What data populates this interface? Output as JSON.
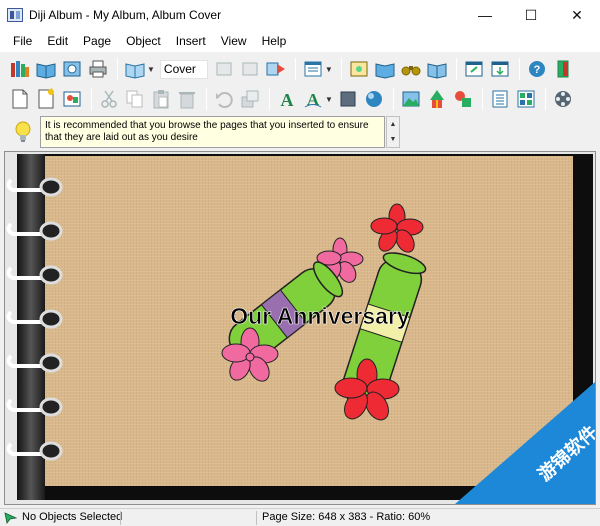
{
  "window": {
    "title": "Diji Album - My Album, Album Cover",
    "minimize": "—",
    "maximize": "☐",
    "close": "✕"
  },
  "menu": [
    "File",
    "Edit",
    "Page",
    "Object",
    "Insert",
    "View",
    "Help"
  ],
  "toolbar": {
    "page_selector_value": "Cover"
  },
  "hint": {
    "text": "It is recommended that you browse the pages that you inserted to ensure that they are laid out as you desire",
    "scroll_up": "▲",
    "scroll_down": "▼"
  },
  "page": {
    "title_text": "Our Anniversary"
  },
  "status": {
    "selection": "No Objects Selected",
    "page_info": "Page Size: 648 x 383 - Ratio: 60%"
  },
  "watermark": {
    "text": "游锦软件"
  },
  "colors": {
    "linen": "#d9b98d",
    "flower_pink": "#f06aa0",
    "flower_red": "#ee2a35",
    "tube_green": "#7fd03a",
    "band_purple": "#9a6fb0",
    "band_cream": "#f2efa8",
    "watermark_blue": "#1e88d8"
  }
}
